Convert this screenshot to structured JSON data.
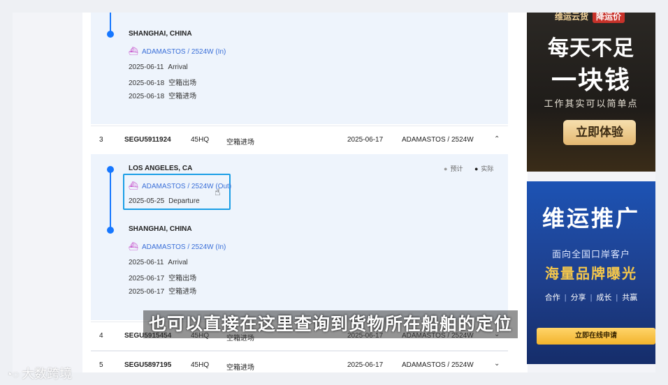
{
  "tracking": {
    "expanded_top": {
      "port": "SHANGHAI, CHINA",
      "vessel": "ADAMASTOS / 2524W (In)",
      "events": [
        {
          "date": "2025-06-11",
          "label": "Arrival"
        },
        {
          "date": "2025-06-18",
          "label": "空箱出场"
        },
        {
          "date": "2025-06-18",
          "label": "空箱进场"
        }
      ]
    },
    "rows": [
      {
        "index": "3",
        "container": "SEGU5911924",
        "type": "45HQ",
        "status": "空箱进场",
        "date": "2025-06-17",
        "vessel": "ADAMASTOS / 2524W",
        "chevron": "⌃"
      },
      {
        "index": "4",
        "container": "SEGU5915454",
        "type": "45HQ",
        "status": "空箱进场",
        "date": "2025-06-17",
        "vessel": "ADAMASTOS / 2524W",
        "chevron": "⌄"
      },
      {
        "index": "5",
        "container": "SEGU5897195",
        "type": "45HQ",
        "status": "空箱进场",
        "date": "2025-06-17",
        "vessel": "ADAMASTOS / 2524W",
        "chevron": "⌄"
      }
    ],
    "expanded_row3": {
      "legend": {
        "estimated": "预计",
        "actual": "实际"
      },
      "stop1": {
        "port": "LOS ANGELES, CA",
        "vessel": "ADAMASTOS / 2524W (Out)",
        "events": [
          {
            "date": "2025-05-25",
            "label": "Departure"
          }
        ]
      },
      "stop2": {
        "port": "SHANGHAI, CHINA",
        "vessel": "ADAMASTOS / 2524W (In)",
        "events": [
          {
            "date": "2025-06-11",
            "label": "Arrival"
          },
          {
            "date": "2025-06-17",
            "label": "空箱出场"
          },
          {
            "date": "2025-06-17",
            "label": "空箱进场"
          }
        ]
      }
    }
  },
  "ads": {
    "ad1": {
      "brand": "维运云货",
      "tag": "降运价",
      "line1": "每天不足",
      "line2": "一块钱",
      "sub": "工作其实可以简单点",
      "button": "立即体验"
    },
    "ad2": {
      "title": "维运推广",
      "sub": "面向全国口岸客户",
      "headline": "海量品牌曝光",
      "tags": [
        "合作",
        "分享",
        "成长",
        "共赢"
      ],
      "button": "立即在线申请"
    }
  },
  "overlay": {
    "subtitle": "也可以直接在这里查询到货物所在船舶的定位",
    "watermark": "大数跨境"
  },
  "colors": {
    "accent": "#1677ff",
    "highlight": "#1a9ee6",
    "ship_icon": "#c23fc6",
    "link": "#3a6fd8"
  }
}
